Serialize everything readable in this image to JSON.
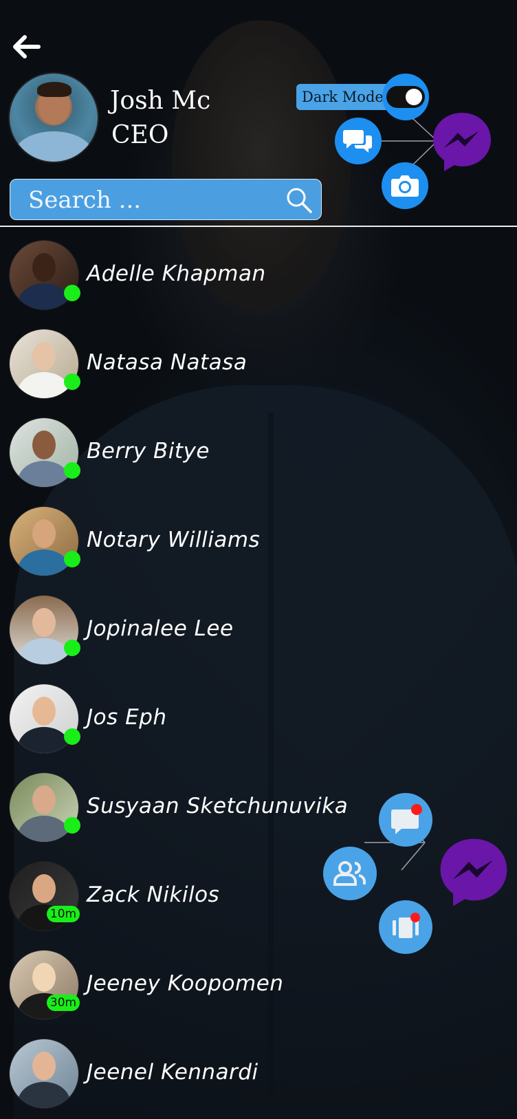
{
  "header": {
    "back_icon": "arrow-left-icon"
  },
  "profile": {
    "name": "Josh Mc",
    "role": "CEO"
  },
  "dark_mode": {
    "label": "Dark Mode",
    "enabled": true
  },
  "search": {
    "placeholder": "Search ...",
    "icon": "search-icon"
  },
  "top_fab": {
    "icons": [
      "chat-bubbles-icon",
      "camera-icon",
      "messenger-icon"
    ]
  },
  "bottom_fab": {
    "icons": [
      "message-notification-icon",
      "groups-icon",
      "stories-notification-icon",
      "messenger-icon"
    ]
  },
  "contacts": [
    {
      "name": "Adelle Khapman",
      "status": "online"
    },
    {
      "name": "Natasa Natasa",
      "status": "online"
    },
    {
      "name": "Berry Bitye",
      "status": "online"
    },
    {
      "name": "Notary Williams",
      "status": "online"
    },
    {
      "name": "Jopinalee Lee",
      "status": "online"
    },
    {
      "name": "Jos Eph",
      "status": "online"
    },
    {
      "name": "Susyaan Sketchunuvika",
      "status": "online"
    },
    {
      "name": "Zack Nikilos",
      "status": "10m"
    },
    {
      "name": "Jeeney Koopomen",
      "status": "30m"
    },
    {
      "name": "Jeenel Kennardi",
      "status": ""
    }
  ],
  "colors": {
    "accent": "#1d8ff0",
    "search_bg": "#4b9fe0",
    "online": "#19ee19",
    "messenger": "#6a16a8",
    "notification": "#ff1a1a"
  }
}
